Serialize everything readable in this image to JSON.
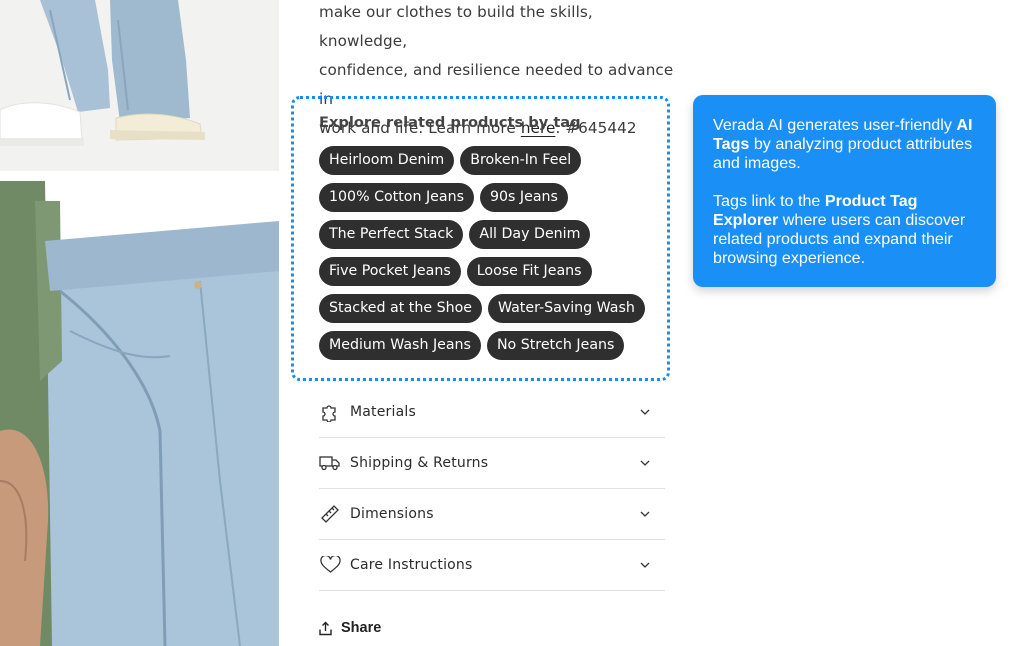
{
  "description": {
    "line1": "make our clothes to build the skills, knowledge,",
    "line2": "confidence, and resilience needed to advance in",
    "line3_pre": "work and life. Learn more ",
    "link_text": "here",
    "line3_post": ". #645442"
  },
  "tags_section": {
    "title": "Explore related products by tag",
    "tags": [
      "Heirloom Denim",
      "Broken-In Feel",
      "100% Cotton Jeans",
      "90s Jeans",
      "The Perfect Stack",
      "All Day Denim",
      "Five Pocket Jeans",
      "Loose Fit Jeans",
      "Stacked at the Shoe",
      "Water-Saving Wash",
      "Medium Wash Jeans",
      "No Stretch Jeans"
    ]
  },
  "accordion": [
    {
      "label": "Materials",
      "icon": "puzzle-icon"
    },
    {
      "label": "Shipping & Returns",
      "icon": "truck-icon"
    },
    {
      "label": "Dimensions",
      "icon": "ruler-icon"
    },
    {
      "label": "Care Instructions",
      "icon": "heart-icon"
    }
  ],
  "share": {
    "label": "Share",
    "icon": "share-icon"
  },
  "callout": {
    "p1_pre": "Verada AI generates user-friendly ",
    "p1_bold": "AI Tags",
    "p1_post": " by analyzing product attributes and images.",
    "p2_pre": "Tags link to the ",
    "p2_bold": "Product Tag Explorer",
    "p2_post": " where users can discover related products and expand their browsing experience."
  },
  "colors": {
    "tag_bg": "#2f2f2f",
    "highlight_border": "#1a8cf0",
    "callout_bg": "#1a8ff5"
  }
}
